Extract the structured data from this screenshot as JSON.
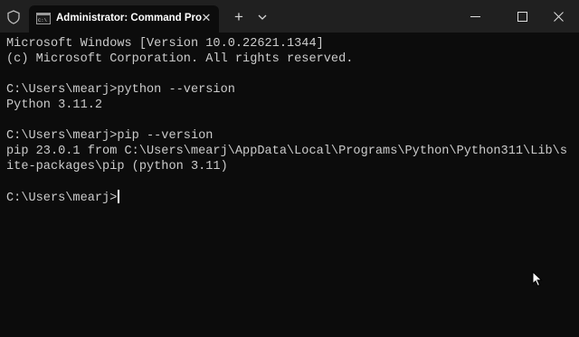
{
  "window": {
    "tab_title": "Administrator: Command Pro",
    "tab_icon": "cmd-icon",
    "new_tab_label": "+",
    "close_tab_label": "✕"
  },
  "terminal": {
    "lines": [
      "Microsoft Windows [Version 10.0.22621.1344]",
      "(c) Microsoft Corporation. All rights reserved.",
      "",
      "C:\\Users\\mearj>python --version",
      "Python 3.11.2",
      "",
      "C:\\Users\\mearj>pip --version",
      "pip 23.0.1 from C:\\Users\\mearj\\AppData\\Local\\Programs\\Python\\Python311\\Lib\\s",
      "ite-packages\\pip (python 3.11)",
      "",
      "C:\\Users\\mearj>"
    ]
  },
  "colors": {
    "terminal_bg": "#0c0c0c",
    "titlebar_bg": "#202020",
    "text": "#cccccc"
  }
}
